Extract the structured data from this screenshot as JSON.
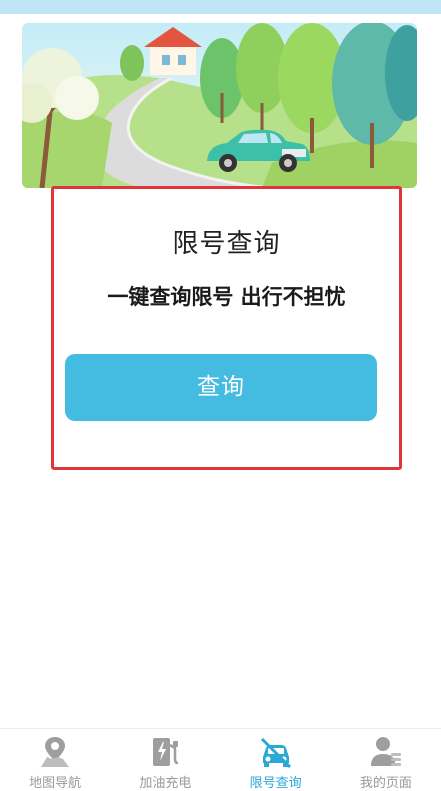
{
  "card": {
    "title": "限号查询",
    "subtitle": "一键查询限号 出行不担忧",
    "button_label": "查询"
  },
  "tabs": [
    {
      "label": "地图导航",
      "icon": "map-pin-icon",
      "active": false
    },
    {
      "label": "加油充电",
      "icon": "charging-station-icon",
      "active": false
    },
    {
      "label": "限号查询",
      "icon": "car-restriction-icon",
      "active": true
    },
    {
      "label": "我的页面",
      "icon": "user-profile-icon",
      "active": false
    }
  ],
  "colors": {
    "accent": "#44bbe0",
    "active_tab": "#2ba8d6",
    "inactive_tab": "#999999",
    "highlight_border": "#e0353a"
  }
}
